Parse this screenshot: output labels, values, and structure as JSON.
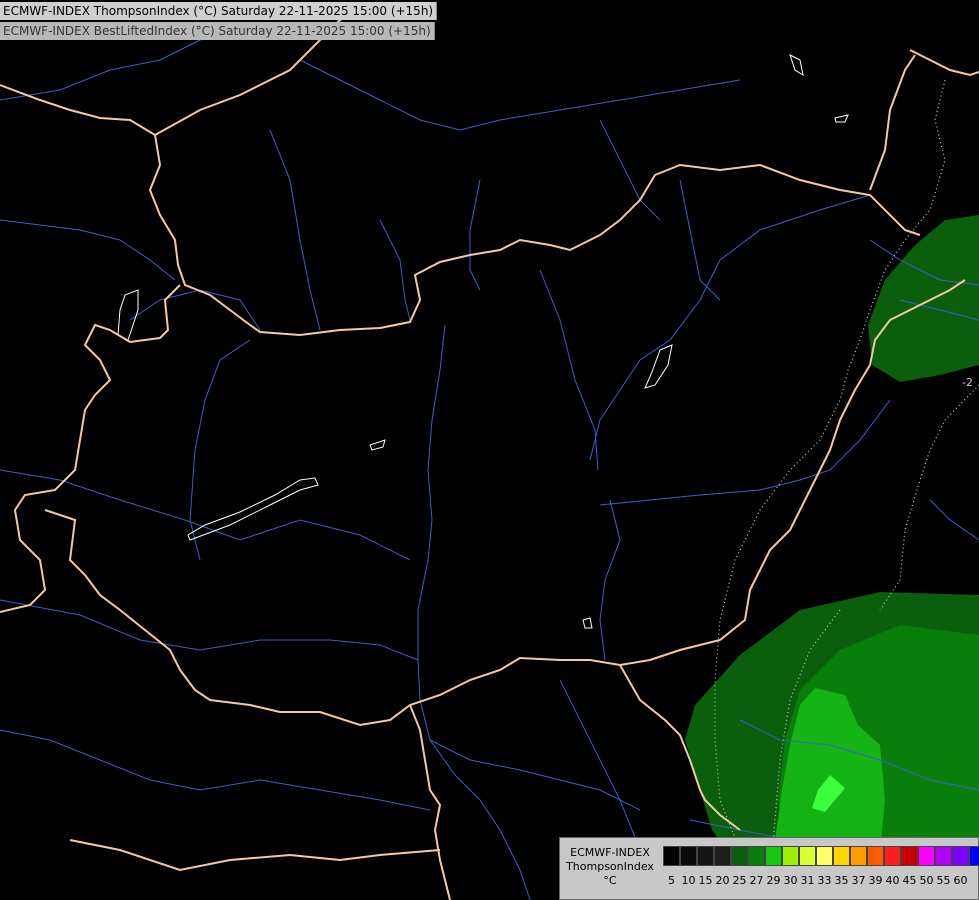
{
  "titles": {
    "line1": "ECMWF-INDEX ThompsonIndex (°C) Saturday 22-11-2025 15:00 (+15h)",
    "line2": "ECMWF-INDEX BestLiftedIndex (°C) Saturday 22-11-2025 15:00 (+15h)"
  },
  "legend": {
    "model": "ECMWF-INDEX",
    "parameter": "ThompsonIndex",
    "unit": "°C",
    "ticks": [
      "5",
      "10",
      "15",
      "20",
      "25",
      "27",
      "29",
      "30",
      "31",
      "33",
      "35",
      "37",
      "39",
      "40",
      "45",
      "50",
      "55",
      "60"
    ],
    "colors": [
      "#000000",
      "#0a0a0a",
      "#141414",
      "#1e1e1e",
      "#0b5e0b",
      "#0a7e0a",
      "#14c814",
      "#9cf000",
      "#d7ff32",
      "#ffff66",
      "#ffd700",
      "#ff9d00",
      "#ff5a00",
      "#ff1e1e",
      "#c80000",
      "#ff00ff",
      "#b400ff",
      "#7d00ff",
      "#0000ff"
    ]
  },
  "map": {
    "background": "#000000",
    "border_color": "#f5c9a0",
    "river_color": "#3a5fcd",
    "lake_color": "#ffffff",
    "contour_label": "-2"
  }
}
